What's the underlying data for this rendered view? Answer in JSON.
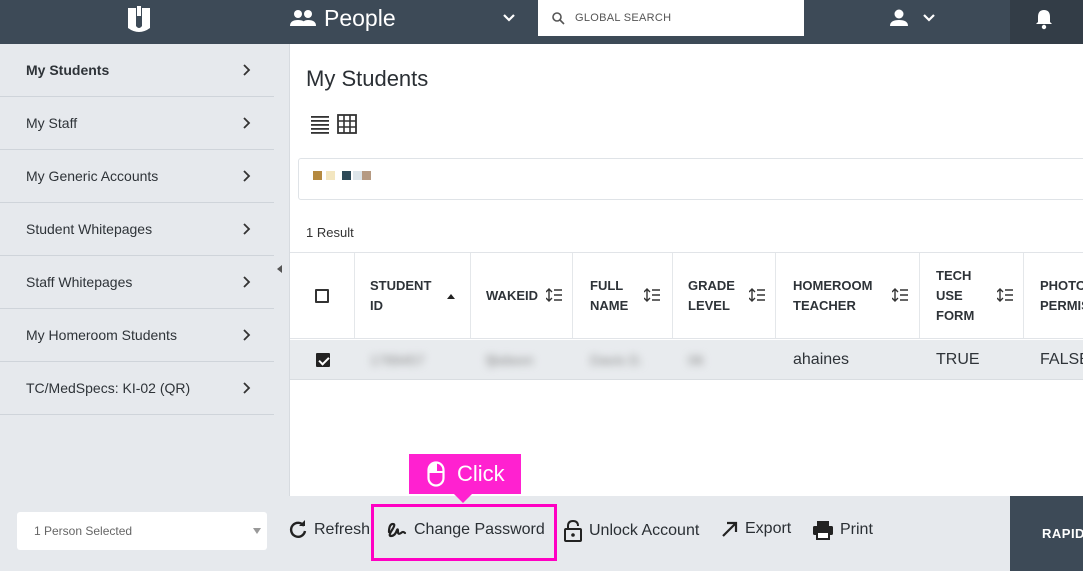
{
  "header": {
    "app_title": "People",
    "search_placeholder": "GLOBAL SEARCH"
  },
  "sidebar": {
    "items": [
      {
        "label": "My Students",
        "active": true
      },
      {
        "label": "My Staff"
      },
      {
        "label": "My Generic Accounts"
      },
      {
        "label": "Student Whitepages"
      },
      {
        "label": "Staff Whitepages"
      },
      {
        "label": "My Homeroom Students"
      },
      {
        "label": "TC/MedSpecs: KI-02 (QR)"
      }
    ]
  },
  "main": {
    "title": "My Students",
    "result_count": "1 Result",
    "columns": [
      {
        "label": "STUDENT ID",
        "sort": "ascending"
      },
      {
        "label": "WAKEID"
      },
      {
        "label": "FULL NAME"
      },
      {
        "label": "GRADE LEVEL"
      },
      {
        "label": "HOMEROOM TEACHER"
      },
      {
        "label": "TECH USE FORM"
      },
      {
        "label": "PHOTO PERMIS"
      }
    ],
    "rows": [
      {
        "selected": true,
        "student_id": "1789457",
        "wakeid": "fjbdwxn",
        "full_name": "Davis D.",
        "grade_level": "06",
        "homeroom_teacher": "ahaines",
        "tech_use_form": "TRUE",
        "photo_permission": "FALSE"
      }
    ]
  },
  "bottom_bar": {
    "selection": "1 Person Selected",
    "actions": {
      "refresh": "Refresh",
      "change_password": "Change Password",
      "unlock_account": "Unlock Account",
      "export": "Export",
      "print": "Print"
    },
    "rapid_label": "RAPID"
  },
  "tooltip": {
    "label": "Click"
  },
  "colors": {
    "topbar": "#3d4a57",
    "sidebar": "#e6e9ed",
    "highlight": "#ff00c3"
  }
}
